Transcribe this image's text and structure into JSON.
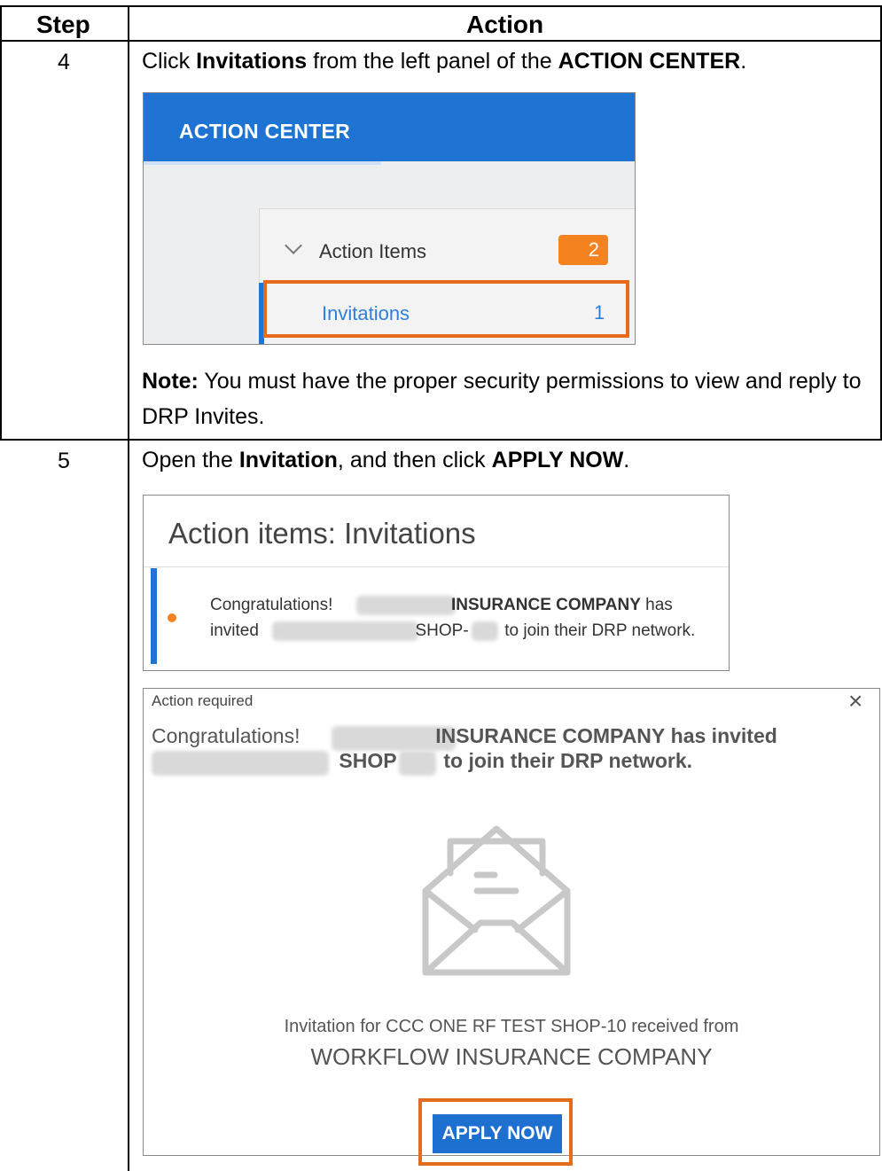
{
  "table": {
    "headers": {
      "step": "Step",
      "action": "Action"
    },
    "rows": [
      {
        "step": "4",
        "instruction": {
          "pre": "Click ",
          "b1": "Invitations",
          "mid": " from the left panel of the ",
          "b2": "ACTION CENTER",
          "post": "."
        },
        "note_label": "Note:",
        "note_text": " You must have the proper security permissions to view and reply to DRP Invites."
      },
      {
        "step": "5",
        "instruction": {
          "pre": "Open the ",
          "b1": "Invitation",
          "mid": ", and then click ",
          "b2": "APPLY NOW",
          "post": "."
        }
      }
    ]
  },
  "action_center": {
    "title": "ACTION CENTER",
    "action_items_label": "Action Items",
    "action_items_count": "2",
    "invitations_label": "Invitations",
    "invitations_count": "1"
  },
  "invitations_list": {
    "title": "Action items: Invitations",
    "line1_a": "Congratulations!",
    "line1_b": "INSURANCE COMPANY",
    "line1_c": "has",
    "line2_a": "invited",
    "line2_b": "SHOP-",
    "line2_c": "to join their DRP network."
  },
  "dialog": {
    "header": "Action required",
    "close": "×",
    "line1_a": "Congratulations!",
    "line1_b": "INSURANCE COMPANY",
    "line1_c": "has invited",
    "line2_a": "SHOP",
    "line2_b": "to join their DRP network.",
    "invitation_text": "Invitation for CCC ONE RF TEST SHOP-10 received from",
    "company": "WORKFLOW INSURANCE COMPANY",
    "apply_button": "APPLY NOW"
  },
  "colors": {
    "highlight": "#e46c1c",
    "brand_blue": "#1f74d3",
    "badge_orange": "#f4831f"
  }
}
